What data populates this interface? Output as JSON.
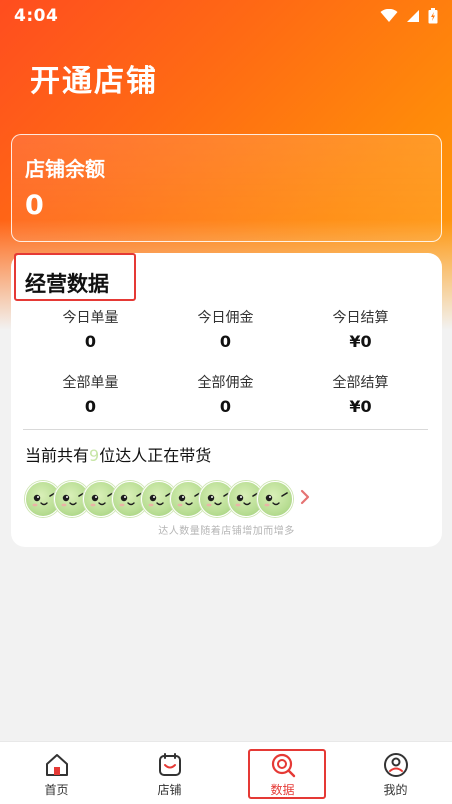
{
  "status_bar": {
    "time": "4:04"
  },
  "header": {
    "title": "开通店铺"
  },
  "balance": {
    "label": "店铺余额",
    "value": "0"
  },
  "business": {
    "title": "经营数据",
    "stats": [
      {
        "label": "今日单量",
        "value": "0"
      },
      {
        "label": "今日佣金",
        "value": "0"
      },
      {
        "label": "今日结算",
        "value": "¥0"
      },
      {
        "label": "全部单量",
        "value": "0"
      },
      {
        "label": "全部佣金",
        "value": "0"
      },
      {
        "label": "全部结算",
        "value": "¥0"
      }
    ],
    "talent_prefix": "当前共有",
    "talent_count": "9",
    "talent_suffix": "位达人正在带货",
    "avatar_count": 9,
    "hint": "达人数量随着店铺增加而增多"
  },
  "bottom_nav": {
    "items": [
      {
        "label": "首页",
        "icon": "home-icon"
      },
      {
        "label": "店铺",
        "icon": "shop-icon"
      },
      {
        "label": "数据",
        "icon": "data-search-icon",
        "active": true
      },
      {
        "label": "我的",
        "icon": "profile-icon"
      }
    ]
  },
  "colors": {
    "accent": "#e53935",
    "header_start": "#ff4d1f",
    "header_end": "#ffa012",
    "avatar_green": "#b9de94"
  }
}
